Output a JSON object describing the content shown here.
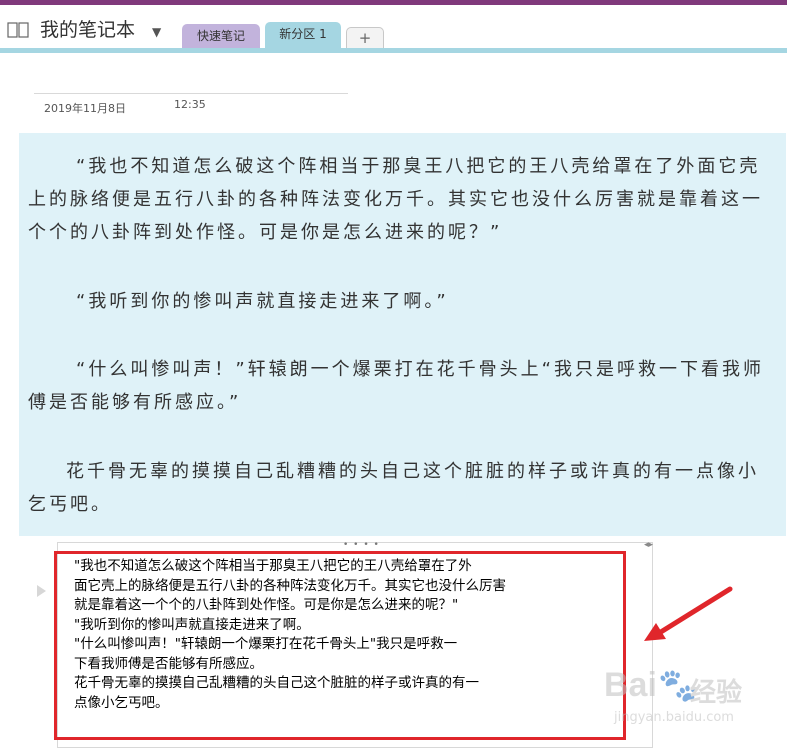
{
  "notebook": {
    "title": "我的笔记本",
    "tabs": [
      {
        "label": "快速笔记"
      },
      {
        "label": "新分区 1"
      }
    ],
    "add_tab_label": "+"
  },
  "page": {
    "date": "2019年11月8日",
    "time": "12:35",
    "paragraphs": [
      "“我也不知道怎么破这个阵相当于那臭王八把它的王八壳给罩在了外面它壳上的脉络便是五行八卦的各种阵法变化万千。其实它也没什么厉害就是靠着这一个个的八卦阵到处作怪。可是你是怎么进来的呢？”",
      "“我听到你的惨叫声就直接走进来了啊。”",
      "“什么叫惨叫声！”轩辕朗一个爆栗打在花千骨头上“我只是呼救一下看我师傅是否能够有所感应。”",
      "花千骨无辜的摸摸自己乱糟糟的头自己这个脏脏的样子或许真的有一点像小乞丐吧。"
    ],
    "pasted_lines": [
      "\"我也不知道怎么破这个阵相当于那臭王八把它的王八壳给罩在了外",
      "面它壳上的脉络便是五行八卦的各种阵法变化万千。其实它也没什么厉害",
      "就是靠着这一个个的八卦阵到处作怪。可是你是怎么进来的呢？\"",
      "\"我听到你的惨叫声就直接走进来了啊。",
      "\"什么叫惨叫声！\"轩辕朗一个爆栗打在花千骨头上\"我只是呼救一",
      "下看我师傅是否能够有所感应。",
      "花千骨无辜的摸摸自己乱糟糟的头自己这个脏脏的样子或许真的有一",
      "点像小乞丐吧。"
    ]
  },
  "watermark": {
    "logo": "Bai",
    "cn": "经验",
    "url": "jingyan.baidu.com"
  },
  "colors": {
    "title_bar": "#80397b",
    "tab_quick": "#c2b3dc",
    "tab_active": "#a5d6e2",
    "note_bg": "#dff2f8",
    "highlight": "#e0262b"
  }
}
